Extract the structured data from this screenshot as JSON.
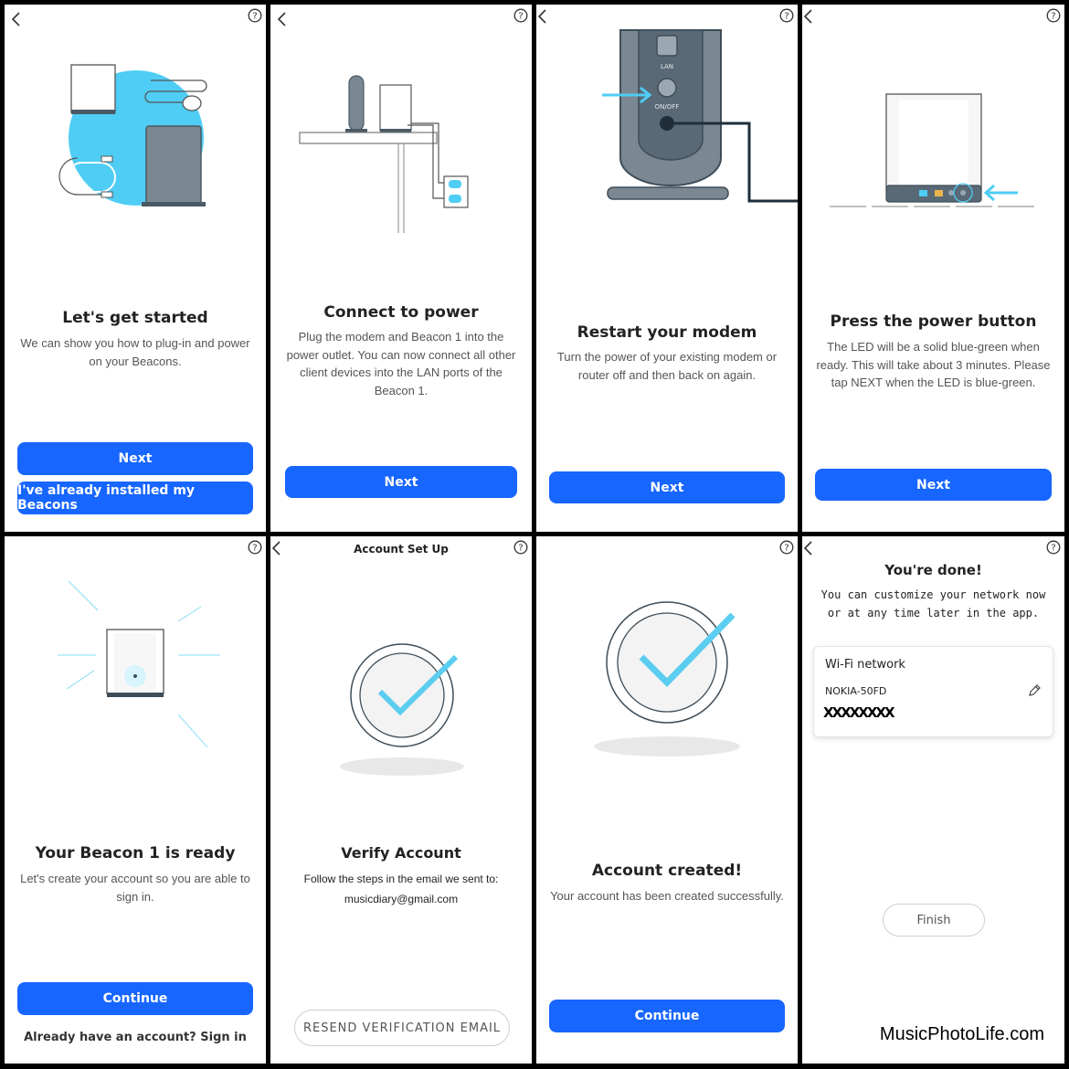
{
  "screens": [
    {
      "title": "Let's get started",
      "description": "We can show you how to plug-in and power on your Beacons.",
      "primary_button": "Next",
      "secondary_button": "I've already installed my Beacons"
    },
    {
      "title": "Connect to power",
      "description": "Plug the modem and Beacon 1 into the power outlet. You can now connect all other client devices into the LAN ports of the Beacon 1.",
      "primary_button": "Next"
    },
    {
      "title": "Restart your modem",
      "description": "Turn the power of your existing modem or router off and then back on again.",
      "primary_button": "Next",
      "illustration_labels": {
        "lan": "LAN",
        "onoff": "ON/OFF"
      }
    },
    {
      "title": "Press the power button",
      "description": "The LED will be a solid blue-green when ready. This will take about 3 minutes. Please tap NEXT when the LED is blue-green.",
      "primary_button": "Next"
    },
    {
      "title": "Your Beacon 1 is ready",
      "description": "Let's create your account so you are able to sign in.",
      "primary_button": "Continue",
      "link": "Already have an account? Sign in"
    },
    {
      "header": "Account Set Up",
      "title": "Verify Account",
      "description": "Follow the steps in the email we sent to:",
      "email": "musicdiary@gmail.com",
      "outline_button": "RESEND VERIFICATION EMAIL"
    },
    {
      "title": "Account created!",
      "description": "Your account has been created successfully.",
      "primary_button": "Continue"
    },
    {
      "title": "You're done!",
      "description_line1": "You can customize your network now",
      "description_line2": "or at any time later in the app.",
      "card_title": "Wi-Fi network",
      "network_name": "NOKIA-50FD",
      "password_masked": "XXXXXXXX",
      "outline_button": "Finish"
    }
  ],
  "icons": {
    "back": "chevron-left-icon",
    "help": "question-circle-icon",
    "edit": "pencil-icon"
  },
  "colors": {
    "primary_button": "#1766ff",
    "illustration_accent": "#4fcdf5",
    "illustration_gray": "#7b8791"
  },
  "watermark": "MusicPhotoLife.com"
}
